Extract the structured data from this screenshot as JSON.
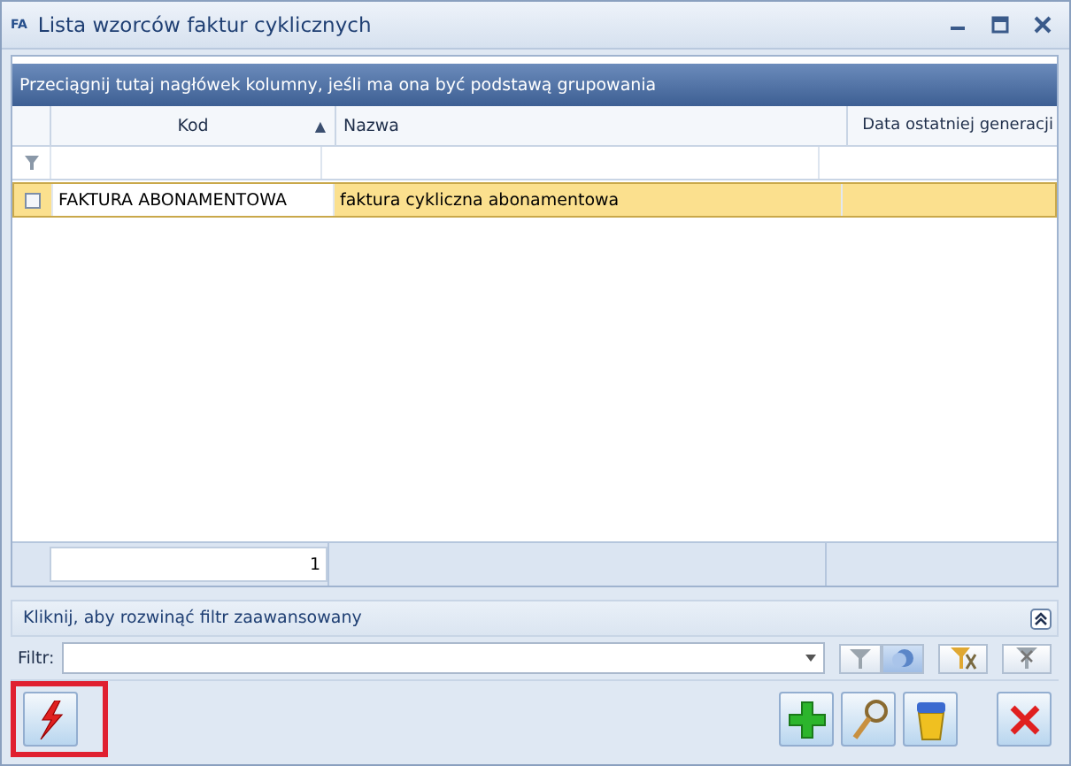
{
  "window": {
    "title": "Lista wzorców faktur cyklicznych",
    "icon_text": "FA"
  },
  "group_panel": {
    "hint": "Przeciągnij tutaj nagłówek kolumny, jeśli ma ona być podstawą grupowania"
  },
  "table": {
    "columns": [
      {
        "label": "Kod",
        "sort": "▲"
      },
      {
        "label": "Nazwa"
      },
      {
        "label": "Data ostatniej generacji"
      }
    ],
    "rows": [
      {
        "checked": false,
        "selected": true,
        "cells": [
          "FAKTURA ABONAMENTOWA",
          "faktura cykliczna abonamentowa"
        ]
      }
    ],
    "footer": {
      "count": "1"
    }
  },
  "advanced_filter": {
    "label": "Kliknij, aby rozwinąć filtr zaawansowany"
  },
  "filter": {
    "label": "Filtr:"
  },
  "run_button": {
    "highlighted": true
  }
}
